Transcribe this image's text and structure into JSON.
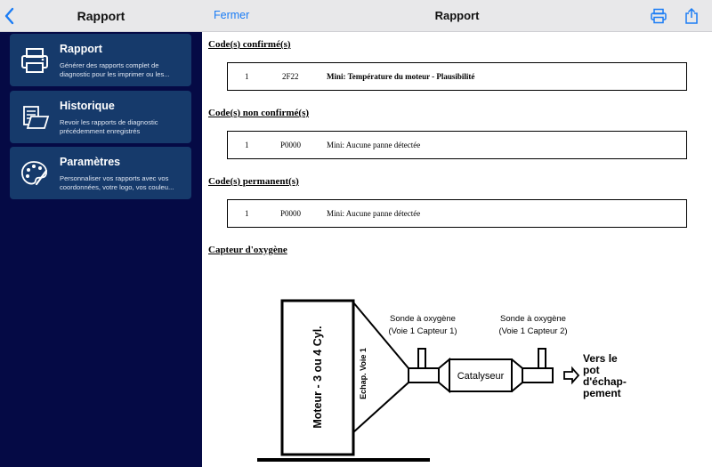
{
  "sidebar": {
    "title": "Rapport",
    "items": [
      {
        "title": "Rapport",
        "description": "Générer des rapports complet de diagnostic pour les imprimer ou les..."
      },
      {
        "title": "Historique",
        "description": "Revoir les rapports de diagnostic précédemment enregistrés"
      },
      {
        "title": "Paramètres",
        "description": "Personnaliser vos rapports avec vos coordonnées, votre logo, vos couleu..."
      }
    ]
  },
  "header": {
    "close_label": "Fermer",
    "title": "Rapport"
  },
  "report": {
    "confirmed": {
      "heading": "Code(s) confirmé(s)",
      "row": {
        "num": "1",
        "code": "2F22",
        "desc": "Mini: Température du moteur - Plausibilité"
      }
    },
    "unconfirmed": {
      "heading": "Code(s) non confirmé(s)",
      "row": {
        "num": "1",
        "code": "P0000",
        "desc": "Mini: Aucune panne détectée"
      }
    },
    "permanent": {
      "heading": "Code(s) permanent(s)",
      "row": {
        "num": "1",
        "code": "P0000",
        "desc": "Mini: Aucune panne détectée"
      }
    },
    "oxygen": {
      "heading": "Capteur d'oxygène",
      "engine_label": "Moteur - 3 ou 4 Cyl.",
      "exhaust_label": "Echap. Voie 1",
      "sensor1_line1": "Sonde à oxygène",
      "sensor1_line2": "(Voie 1 Capteur 1)",
      "sensor2_line1": "Sonde à oxygène",
      "sensor2_line2": "(Voie 1 Capteur 2)",
      "catalyst_label": "Catalyseur",
      "outlet_line1": "Vers le",
      "outlet_line2": "pot",
      "outlet_line3": "d'échap-",
      "outlet_line4": "pement"
    }
  },
  "icons": {
    "back": "chevron-left-icon",
    "print": "printer-icon",
    "share": "share-icon",
    "history": "documents-icon",
    "settings": "palette-icon"
  },
  "colors": {
    "accent": "#1a7cf5",
    "sidebar_bg": "#050a45",
    "card_bg": "#163a6b"
  }
}
